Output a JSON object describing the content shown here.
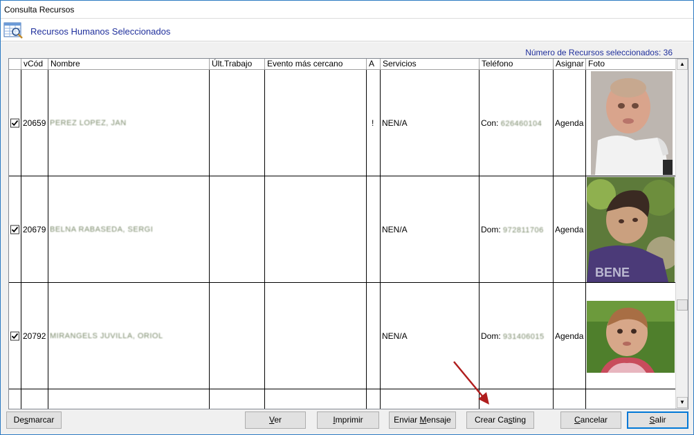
{
  "window": {
    "title": "Consulta Recursos"
  },
  "header": {
    "title": "Recursos Humanos Seleccionados"
  },
  "summary": {
    "count_label": "Número de Recursos seleccionados: 36"
  },
  "table": {
    "columns": [
      "vCód",
      "Nombre",
      "Últ.Trabajo",
      "Evento más cercano",
      "A",
      "Servicios",
      "Teléfono",
      "Asignar",
      "Foto"
    ],
    "rows": [
      {
        "checked": true,
        "code": "20659",
        "name": "PEREZ LOPEZ, JAN",
        "last_job": "",
        "event": "",
        "a": "!",
        "services": "NEN/A",
        "phone_prefix": "Con:",
        "phone": "626460104",
        "assign": "Agenda",
        "photo": "portrait-baby-1"
      },
      {
        "checked": true,
        "code": "20679",
        "name": "BELNA RABASEDA, SERGI",
        "last_job": "",
        "event": "",
        "a": "",
        "services": "NEN/A",
        "phone_prefix": "Dom:",
        "phone": "972811706",
        "assign": "Agenda",
        "photo": "portrait-child-2"
      },
      {
        "checked": true,
        "code": "20792",
        "name": "MIRANGELS JUVILLA, ORIOL",
        "last_job": "",
        "event": "",
        "a": "",
        "services": "NEN/A",
        "phone_prefix": "Dom:",
        "phone": "931406015",
        "assign": "Agenda",
        "photo": "portrait-toddler-3"
      }
    ]
  },
  "buttons": {
    "desmarcar": {
      "pre": "De",
      "key": "s",
      "post": "marcar"
    },
    "ver": {
      "pre": "",
      "key": "V",
      "post": "er"
    },
    "imprimir": {
      "pre": "",
      "key": "I",
      "post": "mprimir"
    },
    "enviar": {
      "pre": "Enviar ",
      "key": "M",
      "post": "ensaje"
    },
    "crear": {
      "pre": "Crear Ca",
      "key": "s",
      "post": "ting"
    },
    "cancelar": {
      "pre": "",
      "key": "C",
      "post": "ancelar"
    },
    "salir": {
      "pre": "",
      "key": "S",
      "post": "alir"
    }
  },
  "colors": {
    "accent": "#1f2f9c",
    "annotation_arrow": "#b01e1e",
    "window_border": "#2b79c2"
  }
}
